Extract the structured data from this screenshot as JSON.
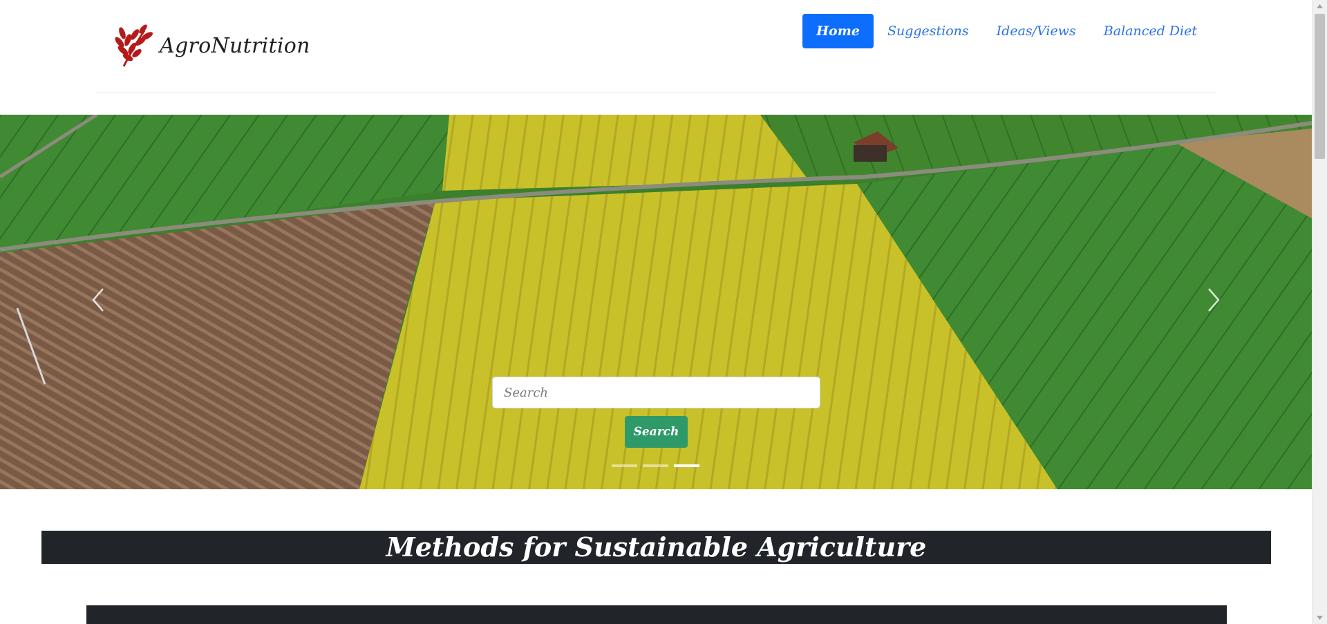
{
  "brand": {
    "name": "AgroNutrition",
    "logo_icon": "wheat-icon",
    "logo_color": "#b51a1a"
  },
  "nav": {
    "items": [
      {
        "label": "Home",
        "active": true
      },
      {
        "label": "Suggestions",
        "active": false
      },
      {
        "label": "Ideas/Views",
        "active": false
      },
      {
        "label": "Balanced Diet",
        "active": false
      }
    ],
    "active_color": "#0d6efd",
    "link_color": "#2b72e8"
  },
  "hero": {
    "image": "aerial view of green, yellow rapeseed and brown plowed farm fields",
    "prev_icon": "chevron-left-icon",
    "next_icon": "chevron-right-icon",
    "search": {
      "placeholder": "Search",
      "value": "",
      "button_label": "Search",
      "button_color": "#2e9a6a"
    },
    "slides": 3,
    "active_slide": 3
  },
  "section": {
    "title": "Methods for Sustainable Agriculture"
  },
  "colors": {
    "dark": "#212529",
    "rule": "#e0e0e0"
  }
}
